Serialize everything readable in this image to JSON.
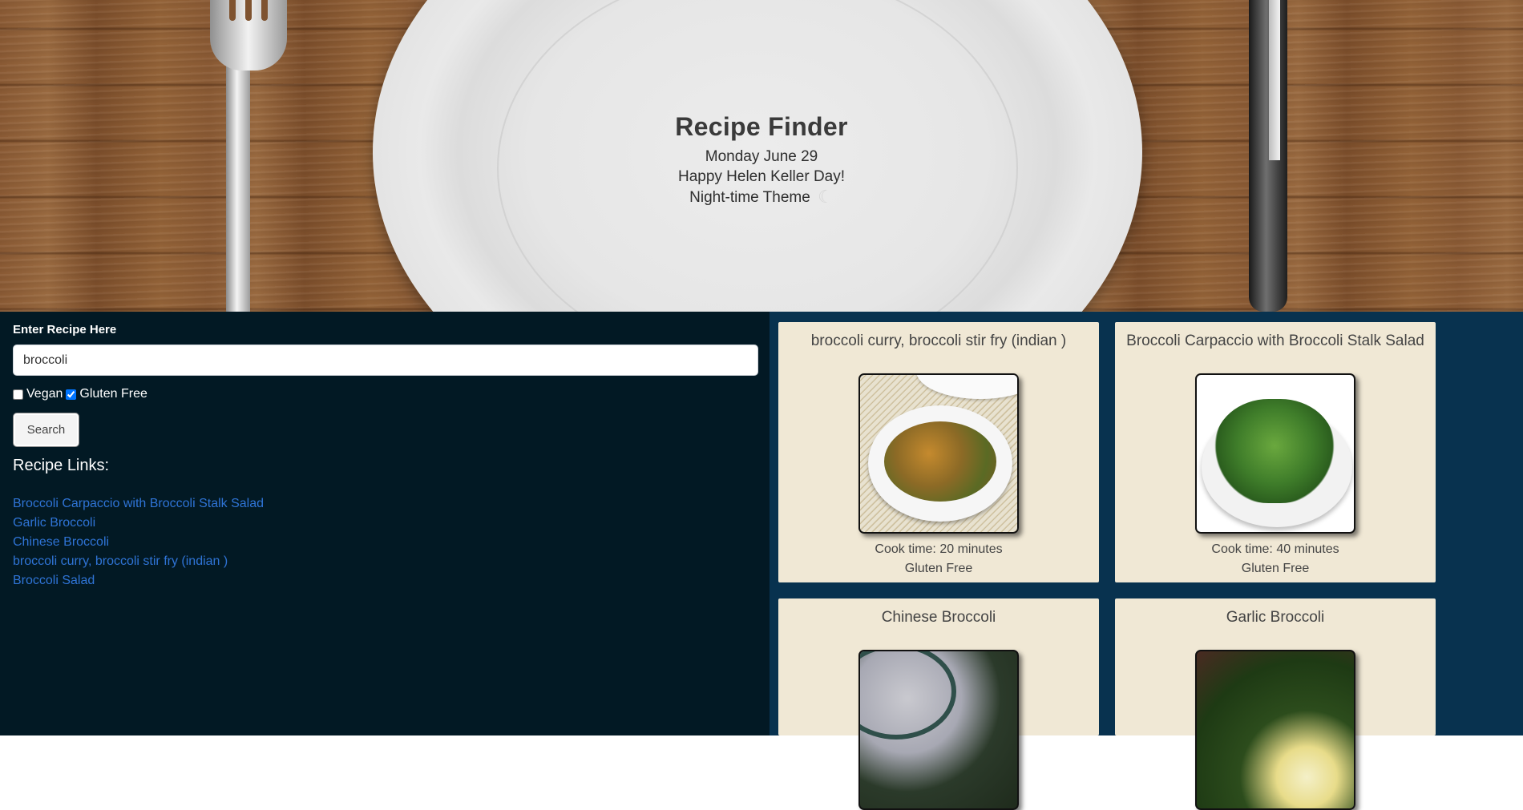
{
  "header": {
    "title": "Recipe Finder",
    "date": "Monday June 29",
    "greeting": "Happy Helen Keller Day!",
    "theme_label": "Night-time Theme",
    "theme_icon": "moon-icon"
  },
  "search": {
    "label": "Enter Recipe Here",
    "value": "broccoli",
    "filters": [
      {
        "label": "Vegan",
        "checked": false
      },
      {
        "label": "Gluten Free",
        "checked": true
      }
    ],
    "button_label": "Search"
  },
  "links": {
    "heading": "Recipe Links:",
    "items": [
      "Broccoli Carpaccio with Broccoli Stalk Salad",
      "Garlic Broccoli",
      "Chinese Broccoli",
      "broccoli curry, broccoli stir fry (indian )",
      "Broccoli Salad"
    ]
  },
  "cards": [
    {
      "title": "broccoli curry, broccoli stir fry (indian )",
      "cook_time": "Cook time: 20 minutes",
      "tag": "Gluten Free"
    },
    {
      "title": "Broccoli Carpaccio with Broccoli Stalk Salad",
      "cook_time": "Cook time: 40 minutes",
      "tag": "Gluten Free"
    },
    {
      "title": "Chinese Broccoli"
    },
    {
      "title": "Garlic Broccoli"
    }
  ],
  "colors": {
    "left_bg": "#021924",
    "right_bg": "#08324f",
    "card_bg": "#f0e8d5",
    "link": "#2f74d6"
  }
}
